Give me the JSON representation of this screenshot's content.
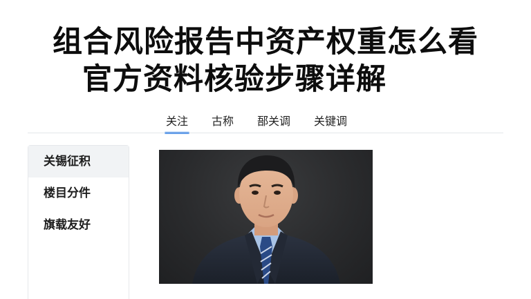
{
  "headline": {
    "line1": "组合风险报告中资产权重怎么看",
    "line2": "官方资料核验步骤详解"
  },
  "tabs": [
    {
      "label": "关注"
    },
    {
      "label": "古称"
    },
    {
      "label": "郚关调"
    },
    {
      "label": "关键调"
    }
  ],
  "sidebar": {
    "items": [
      {
        "label": "关锡征积"
      },
      {
        "label": "楼目分件"
      },
      {
        "label": "旗载友好"
      }
    ]
  },
  "photo": {
    "subject": "portrait of a man in a dark suit and blue striped tie against a dark gray background"
  }
}
